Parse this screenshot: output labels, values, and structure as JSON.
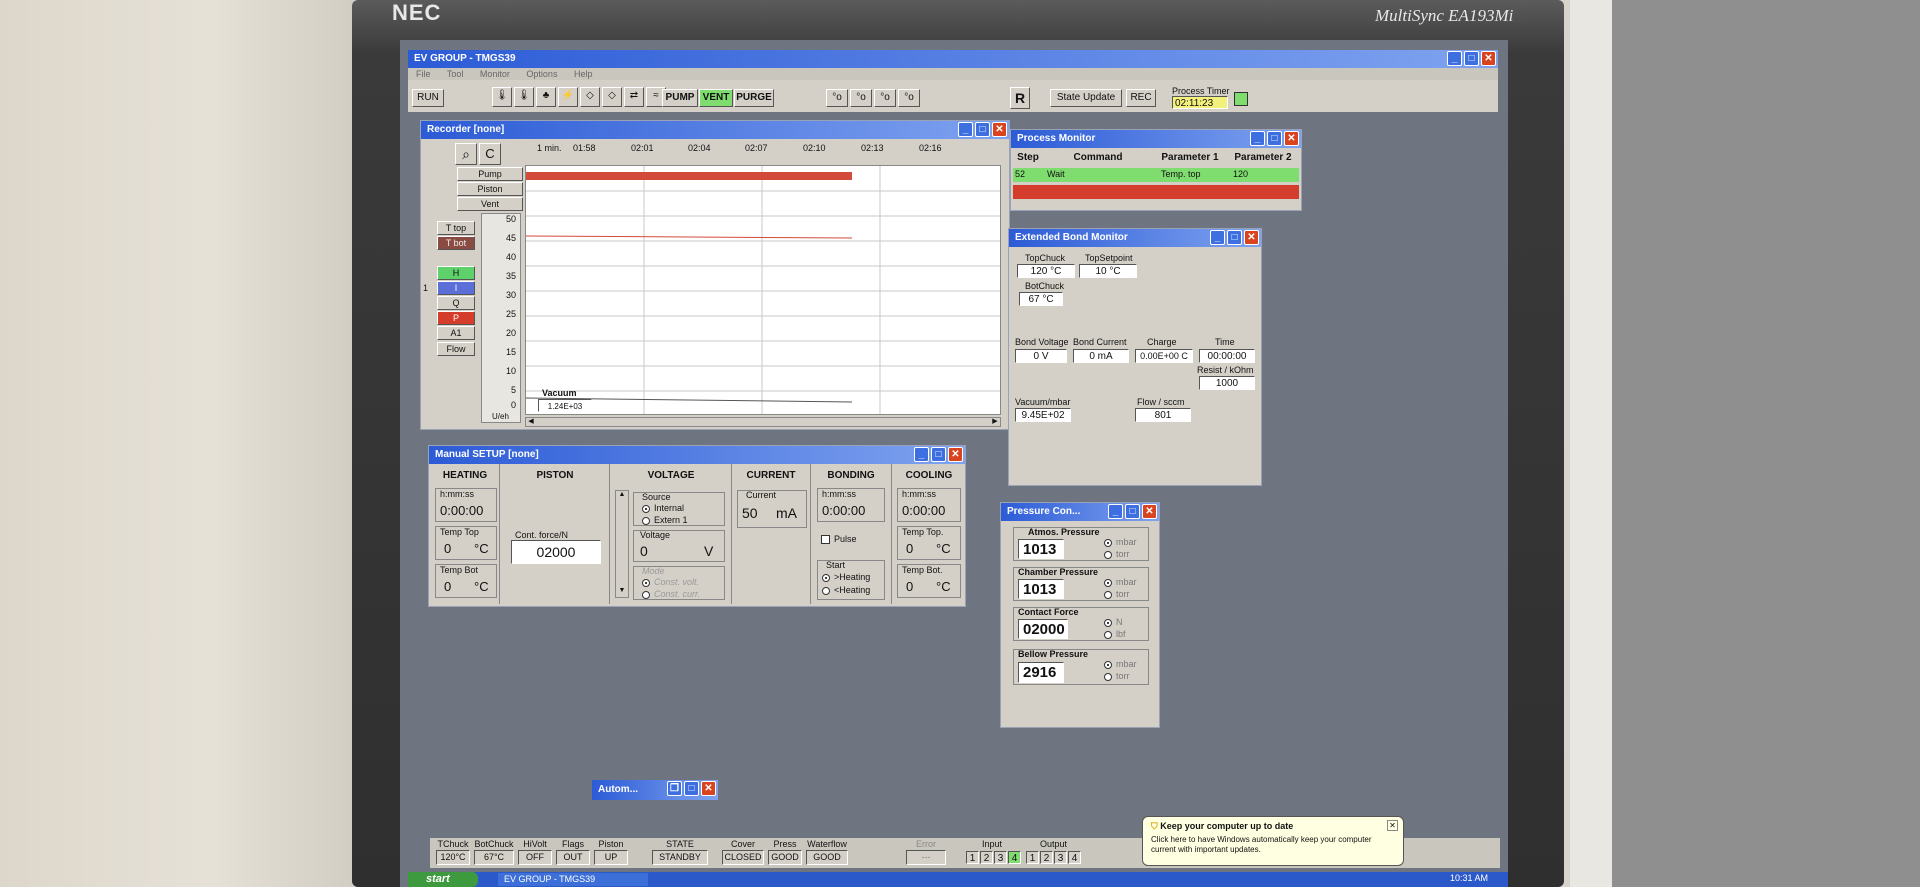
{
  "monitor": {
    "brand": "NEC",
    "model": "MultiSync EA193Mi"
  },
  "app": {
    "title": "EV GROUP - TMGS39",
    "menu": [
      "File",
      "Tool",
      "Monitor",
      "Options",
      "Help"
    ]
  },
  "toolbar": {
    "run": "RUN",
    "pump": "PUMP",
    "vent": "VENT",
    "purge": "PURGE",
    "r": "R",
    "state_update": "State Update",
    "rec": "REC",
    "process_timer_label": "Process Timer",
    "process_timer_value": "02:11:23"
  },
  "recorder": {
    "title": "Recorder [none]",
    "btn_c": "C",
    "time_ticks": [
      "1 min.",
      "01:58",
      "02:01",
      "02:04",
      "02:07",
      "02:10",
      "02:13",
      "02:16"
    ],
    "left_buttons": [
      "Pump",
      "Piston",
      "Vent"
    ],
    "channels": [
      "T top",
      "T bot",
      "H",
      "I",
      "Q",
      "P",
      "A1",
      "Flow"
    ],
    "y_ticks": [
      "50",
      "45",
      "40",
      "35",
      "30",
      "25",
      "20",
      "15",
      "10",
      "5",
      "0"
    ],
    "y_unit": "U/eh",
    "vacuum_label": "Vacuum",
    "vacuum_value": "1.24E+03",
    "marker": "1"
  },
  "process_monitor": {
    "title": "Process Monitor",
    "headers": [
      "Step",
      "Command",
      "Parameter 1",
      "Parameter 2"
    ],
    "row": {
      "step": "52",
      "command": "Wait",
      "p1": "Temp. top",
      "p2": "120"
    }
  },
  "bond_monitor": {
    "title": "Extended Bond Monitor",
    "top_chuck_label": "TopChuck",
    "top_chuck_value": "120 °C",
    "top_setpoint_label": "TopSetpoint",
    "top_setpoint_value": "10 °C",
    "bot_chuck_label": "BotChuck",
    "bot_chuck_value": "67 °C",
    "bond_voltage_label": "Bond Voltage",
    "bond_voltage_value": "0 V",
    "bond_current_label": "Bond Current",
    "bond_current_value": "0 mA",
    "charge_label": "Charge",
    "charge_value": "0.00E+00 C",
    "time_label": "Time",
    "time_value": "00:00:00",
    "resist_label": "Resist / kOhm",
    "resist_value": "1000",
    "vacuum_label": "Vacuum/mbar",
    "vacuum_value": "9.45E+02",
    "flow_label": "Flow / sccm",
    "flow_value": "801"
  },
  "manual_setup": {
    "title": "Manual SETUP [none]",
    "headers": [
      "HEATING",
      "PISTON",
      "VOLTAGE",
      "CURRENT",
      "BONDING",
      "COOLING"
    ],
    "heating": {
      "time_label": "h:mm:ss",
      "time_value": "0:00:00",
      "temp_top_label": "Temp Top",
      "temp_top_value": "0",
      "temp_bot_label": "Temp Bot",
      "temp_bot_value": "0",
      "unit": "°C"
    },
    "piston": {
      "force_label": "Cont. force/N",
      "force_value": "02000"
    },
    "voltage": {
      "source_label": "Source",
      "internal": "Internal",
      "extern": "Extern 1",
      "voltage_label": "Voltage",
      "voltage_value": "0",
      "voltage_unit": "V",
      "mode_label": "Mode",
      "mode_opt1": "Const. volt.",
      "mode_opt2": "Const. curr."
    },
    "current": {
      "label": "Current",
      "value": "50",
      "unit": "mA"
    },
    "bonding": {
      "time_label": "h:mm:ss",
      "time_value": "0:00:00",
      "pulse": "Pulse",
      "start_label": "Start",
      "start_opt1": ">Heating",
      "start_opt2": "<Heating"
    },
    "cooling": {
      "time_label": "h:mm:ss",
      "time_value": "0:00:00",
      "temp_top_label": "Temp Top.",
      "temp_top_value": "0",
      "temp_bot_label": "Temp Bot.",
      "temp_bot_value": "0",
      "unit": "°C"
    }
  },
  "pressure": {
    "title": "Pressure Con...",
    "atmos_label": "Atmos. Pressure",
    "atmos_value": "1013",
    "atmos_u1": "mbar",
    "atmos_u2": "torr",
    "chamber_label": "Chamber Pressure",
    "chamber_value": "1013",
    "chamber_u1": "mbar",
    "chamber_u2": "torr",
    "contact_label": "Contact Force",
    "contact_value": "02000",
    "contact_u1": "N",
    "contact_u2": "lbf",
    "bellow_label": "Bellow Pressure",
    "bellow_value": "2916",
    "bellow_u1": "mbar",
    "bellow_u2": "torr"
  },
  "mini_window": {
    "title": "Autom..."
  },
  "statusbar": {
    "cells": [
      {
        "label": "TChuck",
        "value": "120°C"
      },
      {
        "label": "BotChuck",
        "value": "67°C"
      },
      {
        "label": "HiVolt",
        "value": "OFF"
      },
      {
        "label": "Flags",
        "value": "OUT"
      },
      {
        "label": "Piston",
        "value": "UP"
      },
      {
        "label": "STATE",
        "value": "STANDBY"
      },
      {
        "label": "Cover",
        "value": "CLOSED"
      },
      {
        "label": "Press",
        "value": "GOOD"
      },
      {
        "label": "Waterflow",
        "value": "GOOD"
      },
      {
        "label": "Error",
        "value": "---"
      }
    ],
    "input_label": "Input",
    "inputs": [
      "1",
      "2",
      "3",
      "4"
    ],
    "output_label": "Output",
    "outputs": [
      "1",
      "2",
      "3",
      "4"
    ]
  },
  "notification": {
    "title": "Keep your computer up to date",
    "body": "Click here to have Windows automatically keep your computer current with important updates."
  },
  "taskbar": {
    "start": "start",
    "task": "EV GROUP - TMGS39",
    "clock": "10:31 AM"
  },
  "colors": {
    "title_blue": "#2c5bd6",
    "active_green": "#7fdc6f",
    "alarm_red": "#d43c2c",
    "chart_line": "#d24a3a"
  }
}
